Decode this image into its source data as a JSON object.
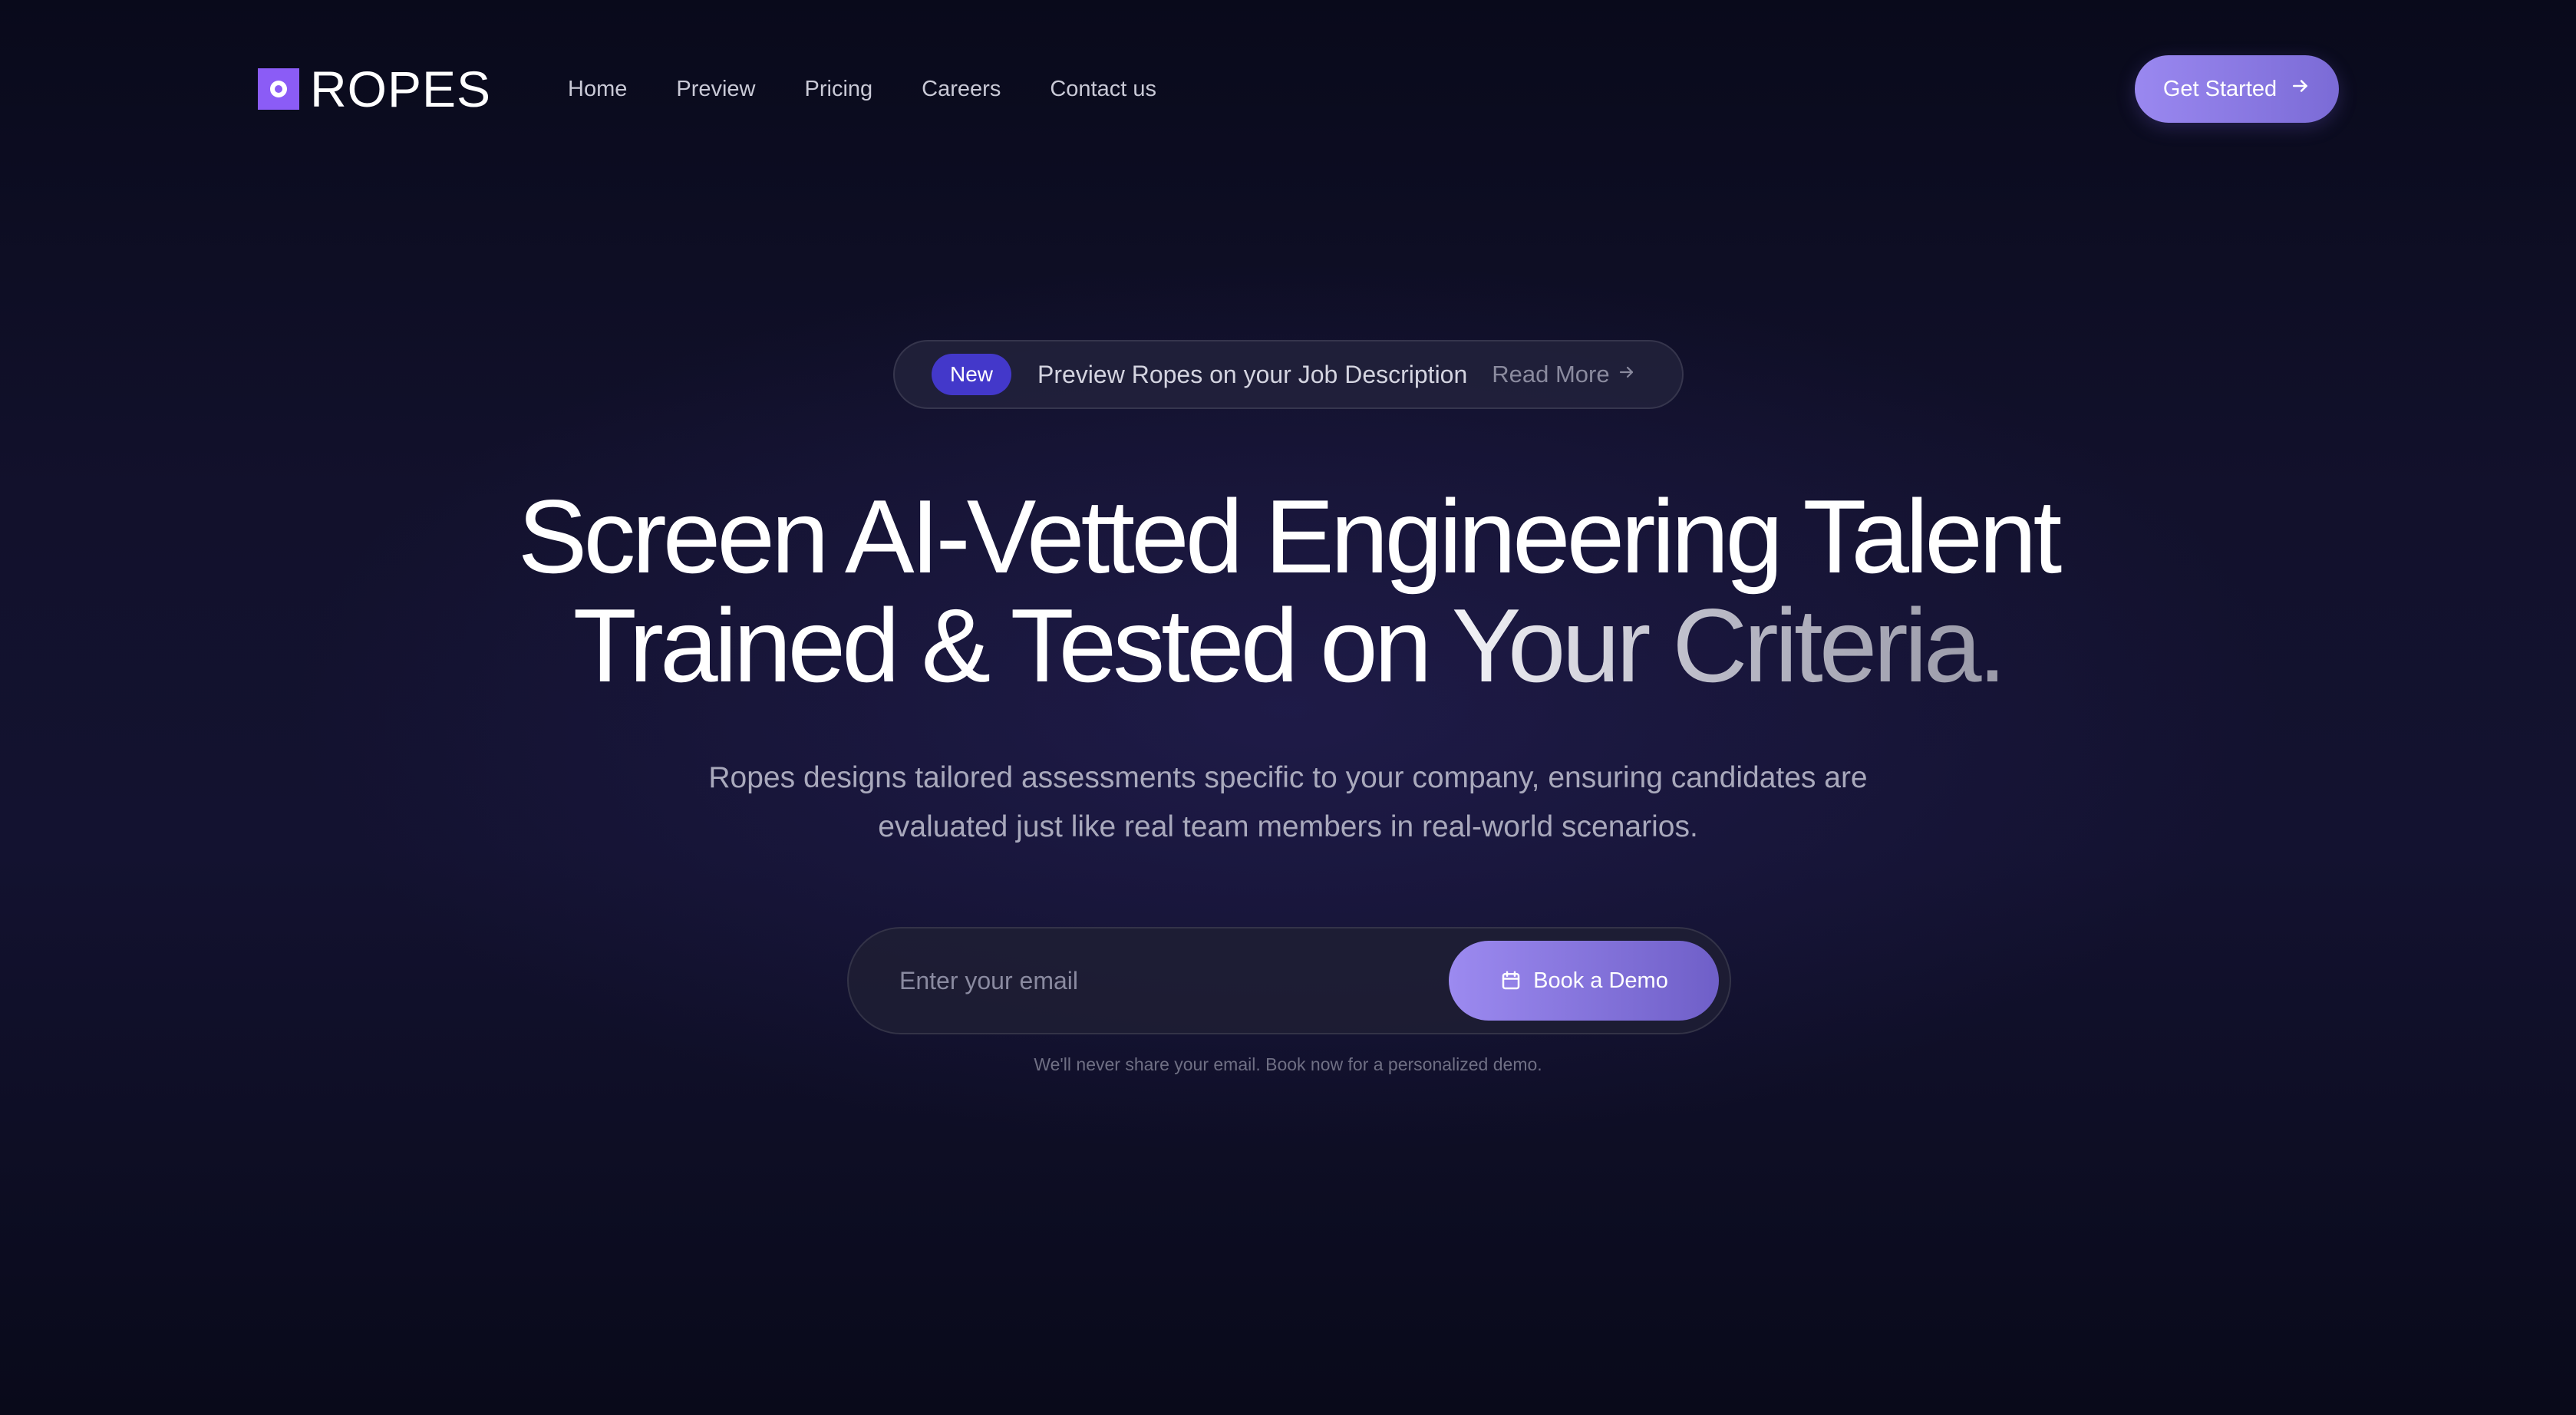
{
  "brand": {
    "name": "ROPES",
    "logo_icon": "logo-square-icon",
    "accent_color": "#8b5cf6"
  },
  "nav": {
    "items": [
      {
        "label": "Home"
      },
      {
        "label": "Preview"
      },
      {
        "label": "Pricing"
      },
      {
        "label": "Careers"
      },
      {
        "label": "Contact us"
      }
    ]
  },
  "header": {
    "cta_label": "Get Started",
    "cta_icon": "arrow-right-icon"
  },
  "announcement": {
    "badge": "New",
    "text": "Preview Ropes on your Job Description",
    "link_label": "Read More",
    "link_icon": "arrow-right-icon"
  },
  "hero": {
    "headline_line1": "Screen AI-Vetted Engineering Talent",
    "headline_line2_part1": "Trained & Tested on ",
    "headline_line2_part2": "Your Criteria.",
    "subtitle_line1": "Ropes designs tailored assessments specific to your company, ensuring candidates are",
    "subtitle_line2": "evaluated just like real team members in real-world scenarios."
  },
  "form": {
    "email_value": "",
    "email_placeholder": "Enter your email",
    "submit_label": "Book a Demo",
    "submit_icon": "calendar-icon",
    "disclaimer": "We'll never share your email. Book now for a personalized demo."
  },
  "colors": {
    "background": "#0f0f26",
    "button_gradient_start": "#9c8af0",
    "button_gradient_end": "#6f5fc8",
    "badge": "#4338ca"
  }
}
